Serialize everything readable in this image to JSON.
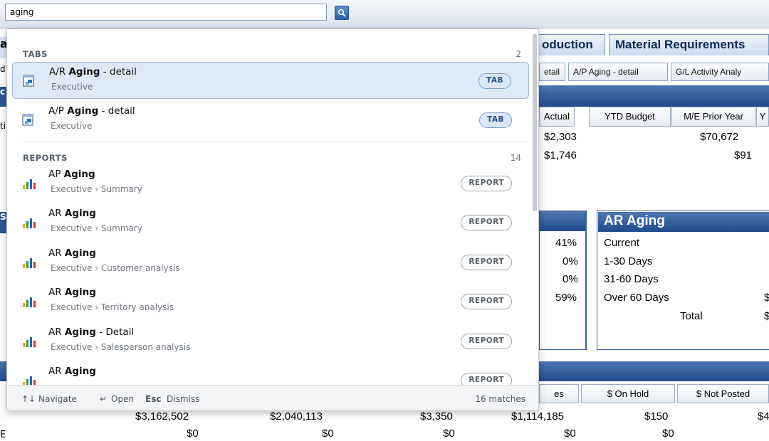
{
  "search": {
    "value": "aging"
  },
  "background": {
    "main_tabs": [
      "oduction",
      "Material Requirements"
    ],
    "sub_tabs": [
      "etail",
      "A/P Aging - detail",
      "G/L Activity Analy"
    ],
    "table_headers": [
      "Actual",
      "YTD Budget",
      "M/E Prior Year",
      "Y"
    ],
    "rows": [
      {
        "actual": "$2,303",
        "prior": "$70,672"
      },
      {
        "actual": "$1,746",
        "prior": "$91"
      }
    ],
    "percents": [
      "41%",
      "0%",
      "0%",
      "59%"
    ],
    "ar_aging": {
      "title": "AR Aging",
      "rows": [
        "Current",
        "1-30 Days",
        "31-60 Days",
        "Over 60 Days"
      ],
      "total_label": "Total"
    },
    "bottom_headers": [
      "es",
      "$ On Hold",
      "$ Not Posted"
    ],
    "bottom_row1": [
      "$3,162,502",
      "$2,040,113",
      "$3,350",
      "$1,114,185",
      "$150",
      "$4"
    ],
    "bottom_row2": [
      "$0",
      "$0",
      "$0",
      "$0",
      "$0"
    ],
    "edge_fragments": [
      "a",
      "d",
      "c",
      "ti",
      "S",
      "E"
    ]
  },
  "dropdown": {
    "tabs_section": {
      "label": "TABS",
      "count": "2"
    },
    "tabs": [
      {
        "title_pre": "A/R ",
        "title_bold": "Aging",
        "title_post": " - detail",
        "subtitle": "Executive",
        "badge": "TAB"
      },
      {
        "title_pre": "A/P ",
        "title_bold": "Aging",
        "title_post": " - detail",
        "subtitle": "Executive",
        "badge": "TAB"
      }
    ],
    "reports_section": {
      "label": "REPORTS",
      "count": "14"
    },
    "reports": [
      {
        "title_pre": "AP ",
        "title_bold": "Aging",
        "title_post": "",
        "subtitle": "Executive › Summary",
        "badge": "REPORT"
      },
      {
        "title_pre": "AR ",
        "title_bold": "Aging",
        "title_post": "",
        "subtitle": "Executive › Summary",
        "badge": "REPORT"
      },
      {
        "title_pre": "AR ",
        "title_bold": "Aging",
        "title_post": "",
        "subtitle": "Executive › Customer analysis",
        "badge": "REPORT"
      },
      {
        "title_pre": "AR ",
        "title_bold": "Aging",
        "title_post": "",
        "subtitle": "Executive › Territory analysis",
        "badge": "REPORT"
      },
      {
        "title_pre": "AR ",
        "title_bold": "Aging",
        "title_post": " - Detail",
        "subtitle": "Executive › Salesperson analysis",
        "badge": "REPORT"
      },
      {
        "title_pre": "AR ",
        "title_bold": "Aging",
        "title_post": "",
        "subtitle": "",
        "badge": "REPORT"
      }
    ],
    "footer": {
      "navigate": "Navigate",
      "open": "Open",
      "esc": "Esc",
      "dismiss": "Dismiss",
      "matches": "16 matches"
    }
  },
  "colors": {
    "accent": "#1f4b8e",
    "selected_row": "#dfe9f6",
    "pill_tab": "#1f4f8f"
  },
  "icons": [
    "search-icon",
    "tab-icon",
    "bar-chart-icon",
    "updown-arrows-icon",
    "return-arrow-icon"
  ]
}
